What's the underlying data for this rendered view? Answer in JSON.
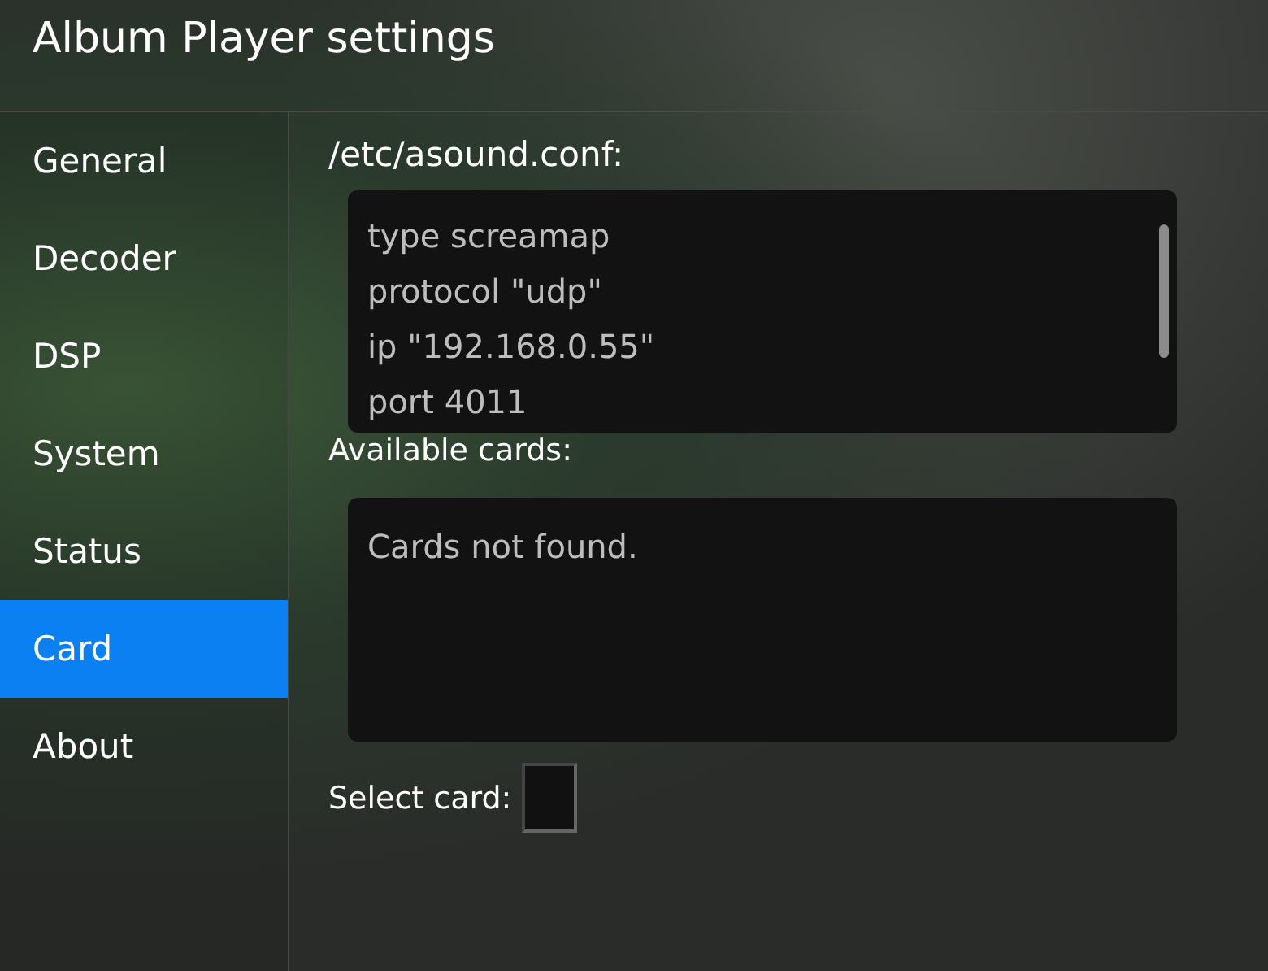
{
  "window": {
    "title": "Album Player settings"
  },
  "sidebar": {
    "items": [
      {
        "label": "General",
        "selected": false
      },
      {
        "label": "Decoder",
        "selected": false
      },
      {
        "label": "DSP",
        "selected": false
      },
      {
        "label": "System",
        "selected": false
      },
      {
        "label": "Status",
        "selected": false
      },
      {
        "label": "Card",
        "selected": true
      },
      {
        "label": "About",
        "selected": false
      }
    ]
  },
  "config": {
    "label": "/etc/asound.conf:",
    "lines": [
      "type screamap",
      "protocol \"udp\"",
      "ip \"192.168.0.55\"",
      "port 4011"
    ]
  },
  "cards": {
    "label": "Available cards:",
    "message": "Cards not found."
  },
  "select_card": {
    "label": "Select card:"
  }
}
